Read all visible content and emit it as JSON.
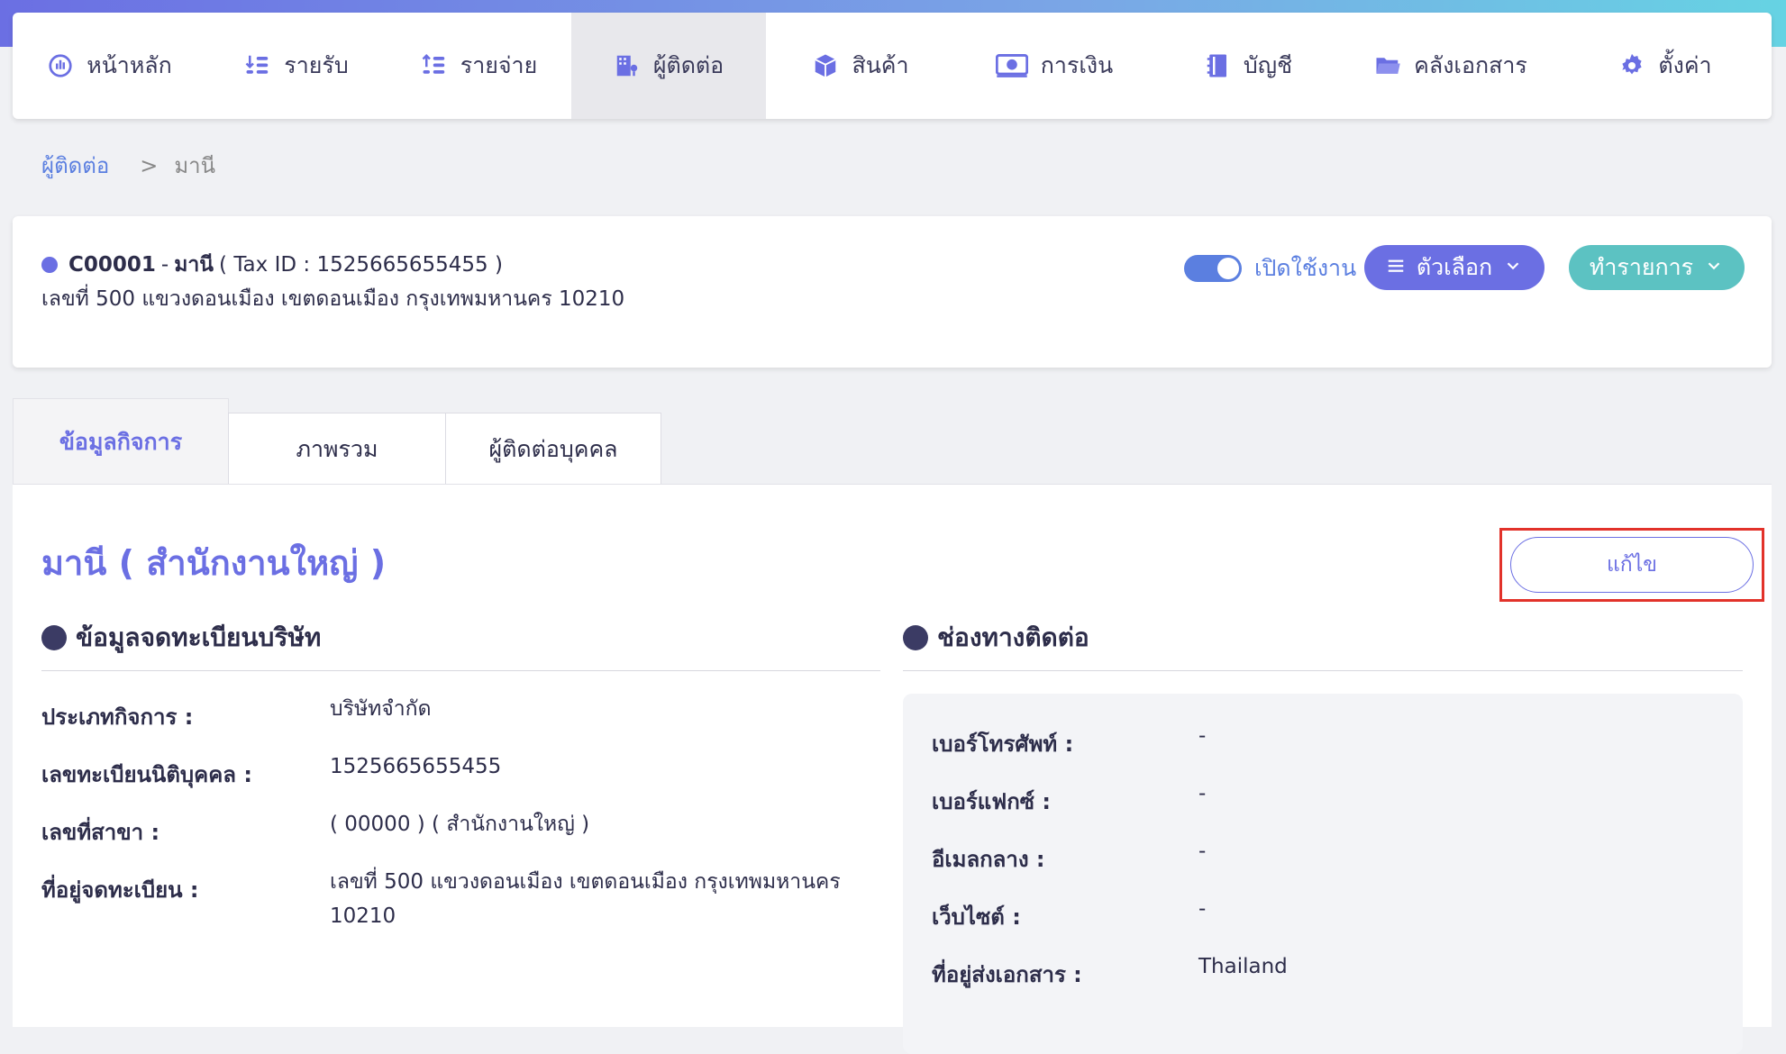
{
  "nav": {
    "items": [
      {
        "label": "หน้าหลัก",
        "icon": "dashboard-icon"
      },
      {
        "label": "รายรับ",
        "icon": "income-icon"
      },
      {
        "label": "รายจ่าย",
        "icon": "expense-icon"
      },
      {
        "label": "ผู้ติดต่อ",
        "icon": "contacts-icon",
        "active": true
      },
      {
        "label": "สินค้า",
        "icon": "box-icon"
      },
      {
        "label": "การเงิน",
        "icon": "money-icon"
      },
      {
        "label": "บัญชี",
        "icon": "book-icon"
      },
      {
        "label": "คลังเอกสาร",
        "icon": "folder-icon"
      },
      {
        "label": "ตั้งค่า",
        "icon": "gear-icon"
      }
    ]
  },
  "breadcrumb": {
    "parent": "ผู้ติดต่อ",
    "separator": ">",
    "current": "มานี"
  },
  "header": {
    "code": "C00001",
    "dash": "-",
    "name": "มานี",
    "tax": "( Tax ID : 1525665655455 )",
    "address": "เลขที่ 500 แขวงดอนเมือง เขตดอนเมือง กรุงเทพมหานคร 10210",
    "toggle_label": "เปิดใช้งาน",
    "options_label": "ตัวเลือก",
    "actions_label": "ทำรายการ"
  },
  "tabs": [
    {
      "label": "ข้อมูลกิจการ",
      "active": true
    },
    {
      "label": "ภาพรวม"
    },
    {
      "label": "ผู้ติดต่อบุคคล"
    }
  ],
  "content": {
    "title": "มานี ( สำนักงานใหญ่ )",
    "edit_label": "แก้ไข",
    "registration": {
      "heading": "ข้อมูลจดทะเบียนบริษัท",
      "fields": [
        {
          "label": "ประเภทกิจการ :",
          "value": "บริษัทจำกัด"
        },
        {
          "label": "เลขทะเบียนนิติบุคคล :",
          "value": "1525665655455"
        },
        {
          "label": "เลขที่สาขา :",
          "value": "( 00000 ) ( สำนักงานใหญ่ )"
        },
        {
          "label": "ที่อยู่จดทะเบียน :",
          "value": "เลขที่ 500 แขวงดอนเมือง เขตดอนเมือง กรุงเทพมหานคร",
          "value2": "10210"
        }
      ]
    },
    "contact": {
      "heading": "ช่องทางติดต่อ",
      "fields": [
        {
          "label": "เบอร์โทรศัพท์ :",
          "value": "-"
        },
        {
          "label": "เบอร์แฟกซ์ :",
          "value": "-"
        },
        {
          "label": "อีเมลกลาง :",
          "value": "-"
        },
        {
          "label": "เว็บไซต์ :",
          "value": "-"
        },
        {
          "label": "ที่อยู่ส่งเอกสาร :",
          "value": "Thailand"
        }
      ]
    }
  },
  "colors": {
    "accent": "#6b6fe3",
    "teal": "#5cc2c2",
    "link": "#5b7fe0",
    "highlight": "#e2322a"
  }
}
